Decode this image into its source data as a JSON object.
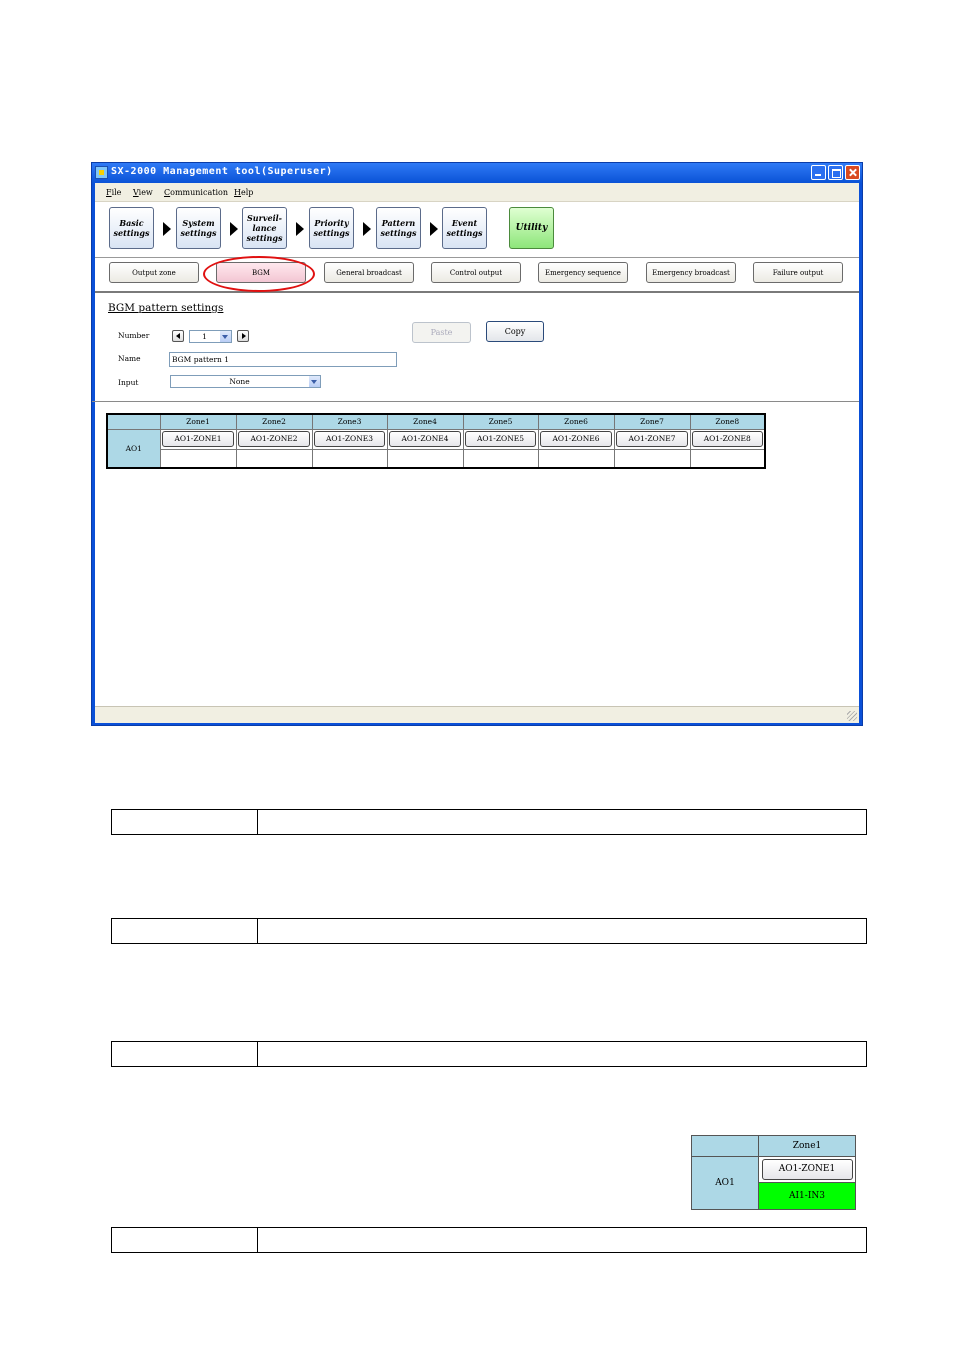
{
  "window": {
    "title": "SX-2000 Management tool(Superuser)"
  },
  "menu": [
    "File",
    "View",
    "Communication",
    "Help"
  ],
  "steps": [
    {
      "lines": [
        "Basic",
        "settings"
      ]
    },
    {
      "lines": [
        "System",
        "settings"
      ]
    },
    {
      "lines": [
        "Surveil-",
        "lance",
        "settings"
      ]
    },
    {
      "lines": [
        "Priority",
        "settings"
      ]
    },
    {
      "lines": [
        "Pattern",
        "settings"
      ]
    },
    {
      "lines": [
        "Event",
        "settings"
      ]
    },
    {
      "lines": [
        "Utility"
      ]
    }
  ],
  "tabs": [
    "Output zone",
    "BGM",
    "General broadcast",
    "Control output",
    "Emergency sequence",
    "Emergency broadcast",
    "Failure output"
  ],
  "active_tab": "BGM",
  "bgm": {
    "section_title": "BGM pattern settings",
    "number_label": "Number",
    "number_value": "1",
    "name_label": "Name",
    "name_value": "BGM pattern 1",
    "input_label": "Input",
    "input_value": "None",
    "paste_label": "Paste",
    "copy_label": "Copy"
  },
  "zone_table": {
    "row_label": "AO1",
    "zones": [
      "Zone1",
      "Zone2",
      "Zone3",
      "Zone4",
      "Zone5",
      "Zone6",
      "Zone7",
      "Zone8"
    ],
    "zone_buttons": [
      "AO1-ZONE1",
      "AO1-ZONE2",
      "AO1-ZONE3",
      "AO1-ZONE4",
      "AO1-ZONE5",
      "AO1-ZONE6",
      "AO1-ZONE7",
      "AO1-ZONE8"
    ]
  },
  "example_table": {
    "header": "Zone1",
    "row_label": "AO1",
    "zone_button": "AO1-ZONE1",
    "assigned_input": "AI1-IN3",
    "assigned_color": "#00ff00"
  },
  "colors": {
    "title_blue": "#0a52d6",
    "header_cell": "#add8e6",
    "highlight_ring": "#e01010"
  }
}
